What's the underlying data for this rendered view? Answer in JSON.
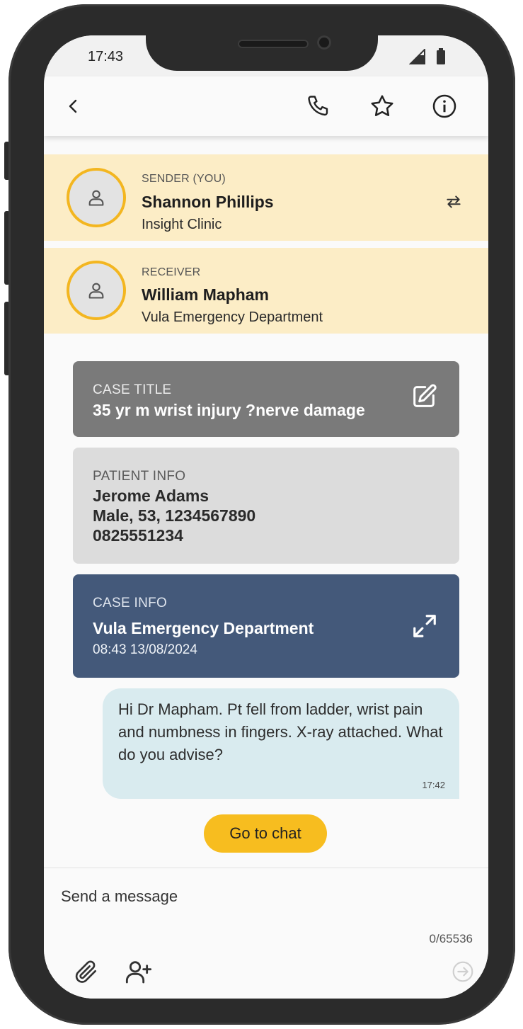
{
  "status_bar": {
    "time": "17:43"
  },
  "app_bar": {
    "back_icon": "chevron-left-icon",
    "call_icon": "phone-icon",
    "favorite_icon": "star-icon",
    "info_icon": "info-icon"
  },
  "sender": {
    "role": "SENDER (YOU)",
    "name": "Shannon Phillips",
    "organization": "Insight Clinic",
    "swap_icon": "swap-icon"
  },
  "receiver": {
    "role": "RECEIVER",
    "name": "William Mapham",
    "organization": "Vula Emergency Department"
  },
  "case_title": {
    "label": "CASE TITLE",
    "value": "35 yr m wrist injury ?nerve damage",
    "edit_icon": "edit-icon"
  },
  "patient_info": {
    "label": "PATIENT INFO",
    "name": "Jerome Adams",
    "details": "Male, 53, 1234567890",
    "phone": "0825551234"
  },
  "case_info": {
    "label": "CASE INFO",
    "department": "Vula Emergency Department",
    "timestamp": "08:43 13/08/2024",
    "expand_icon": "expand-icon"
  },
  "message": {
    "text": "Hi Dr Mapham. Pt fell from ladder, wrist pain and numbness in fingers. X-ray attached. What do you advise?",
    "time": "17:42"
  },
  "go_to_chat_label": "Go to chat",
  "composer": {
    "placeholder": "Send a message",
    "counter": "0/65536"
  },
  "colors": {
    "party_bg": "#fcedc6",
    "avatar_ring": "#f3b620",
    "case_title_bg": "#7a7a7a",
    "patient_info_bg": "#dcdcdc",
    "case_info_bg": "#44597a",
    "bubble_bg": "#d9ebef",
    "button_bg": "#f7bd1f"
  }
}
